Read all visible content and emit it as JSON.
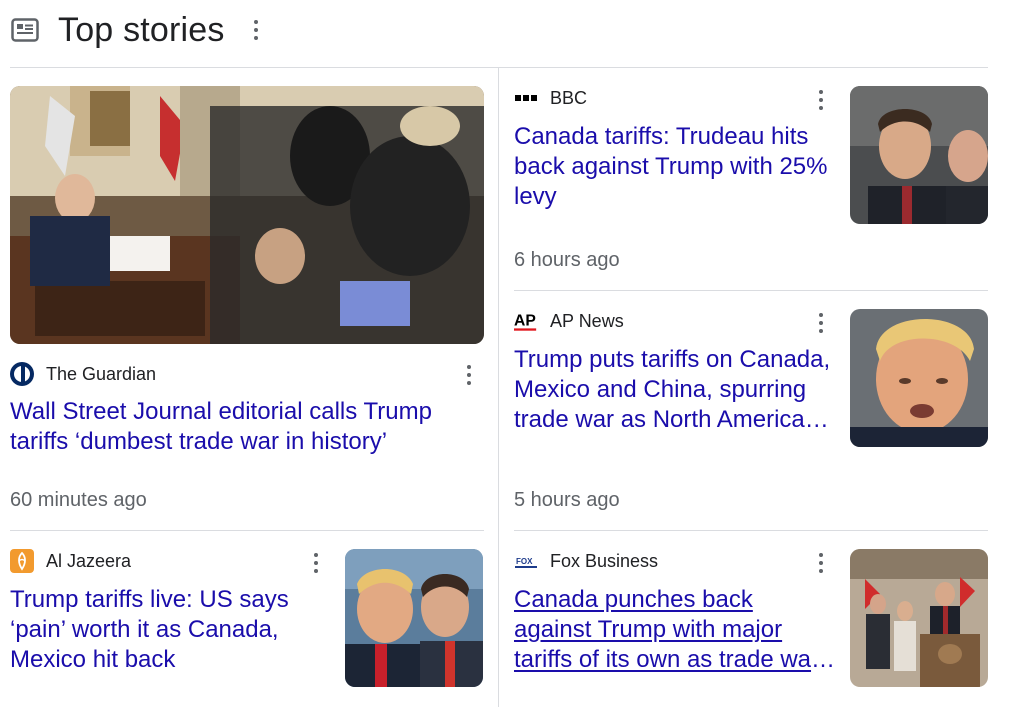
{
  "header": {
    "title": "Top stories",
    "icon": "newspaper-icon"
  },
  "stories": [
    {
      "source": "The Guardian",
      "headline": "Wall Street Journal editorial calls Trump tariffs ‘dumbest trade war in history’",
      "time": "60 minutes ago",
      "logo_color": "#052962"
    },
    {
      "source": "BBC",
      "headline": "Canada tariffs: Trudeau hits back against Trump with 25% levy",
      "time": "6 hours ago",
      "logo_color": "#000000"
    },
    {
      "source": "AP News",
      "headline": "Trump puts tariffs on Canada, Mexico and China, spurring trade war as North American leaders vow retaliation",
      "time": "5 hours ago",
      "logo_color": "#e0161e",
      "logo_text": "AP"
    },
    {
      "source": "Al Jazeera",
      "headline": "Trump tariffs live: US says ‘pain’ worth it as Canada, Mexico hit back",
      "logo_color": "#f29a2e"
    },
    {
      "source": "Fox Business",
      "headline": "Canada punches back against Trump with major tariffs of its own as trade war escalates",
      "logo_color": "#1d3b8b",
      "logo_text": "FOX"
    }
  ],
  "colors": {
    "link": "#1a0dab",
    "time": "#5f6368",
    "divider": "#dadce0"
  }
}
